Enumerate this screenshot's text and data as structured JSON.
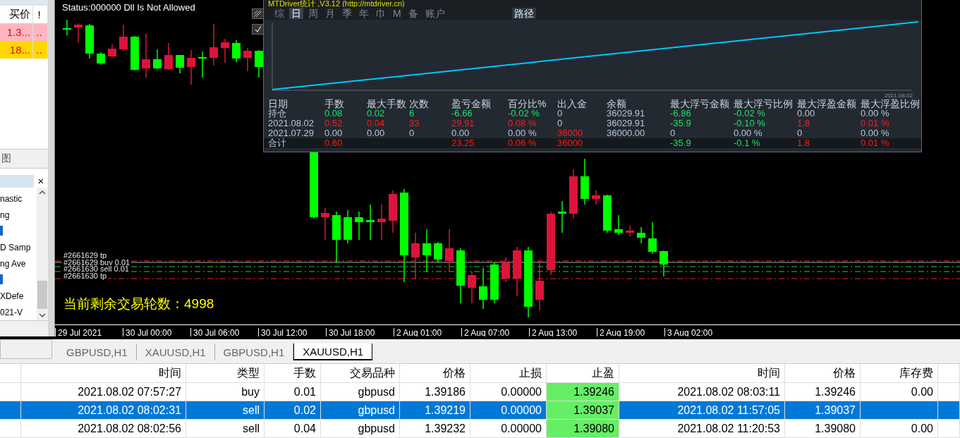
{
  "market_watch": {
    "columns": [
      "买价",
      "!"
    ],
    "rows": [
      {
        "cells": [
          "1.3...",
          ".."
        ],
        "color": "#ffb6c1"
      },
      {
        "cells": [
          "18...",
          ".."
        ],
        "color": "#ffd700"
      }
    ]
  },
  "left_tab": "图",
  "navigator": {
    "close": "×",
    "items": [
      {
        "kind": "text",
        "label": "nastic"
      },
      {
        "kind": "text",
        "label": "ng"
      },
      {
        "kind": "icon"
      },
      {
        "kind": "text",
        "label": "D Samp"
      },
      {
        "kind": "text",
        "label": "ng Ave"
      },
      {
        "kind": "icon"
      },
      {
        "kind": "text",
        "label": "XDefe"
      },
      {
        "kind": "text",
        "label": "021-V"
      }
    ]
  },
  "chart": {
    "status": "Status:000000 Dll Is Not Allowed",
    "order_labels": [
      "#2661629 tp",
      "#2661629 buy 0.01",
      "#2661630 sell 0.01",
      "#2661630 tp"
    ],
    "rounds": "当前剩余交易轮数：4998",
    "time_axis": [
      "29 Jul 2021",
      "30 Jul 00:00",
      "30 Jul 06:00",
      "30 Jul 12:00",
      "30 Jul 18:00",
      "2 Aug 01:00",
      "2 Aug 07:00",
      "2 Aug 13:00",
      "2 Aug 19:00",
      "3 Aug 02:00"
    ]
  },
  "stats_panel": {
    "title": "MTDriver统计 ,V3.12 (http://mtdriver.cn)",
    "tabs": [
      {
        "label": "综",
        "selected": false
      },
      {
        "label": "日",
        "selected": true
      },
      {
        "label": "周",
        "selected": false
      },
      {
        "label": "月",
        "selected": false
      },
      {
        "label": "季",
        "selected": false
      },
      {
        "label": "年",
        "selected": false
      },
      {
        "label": "巾",
        "selected": false
      },
      {
        "label": "M",
        "selected": false
      },
      {
        "label": "备",
        "selected": false
      },
      {
        "label": "账户",
        "selected": false
      }
    ],
    "path_button": "路径",
    "chart_date": "2021.08.02",
    "columns": [
      "日期",
      "手数",
      "最大手数",
      "次数",
      "盈亏金额",
      "百分比%",
      "出入金",
      "余额",
      "最大浮亏金额",
      "最大浮亏比例",
      "最大浮盈金额",
      "最大浮盈比例"
    ],
    "rows": [
      {
        "kind": "period",
        "cells": [
          {
            "text": "持仓",
            "color": "#b8c4d8"
          },
          {
            "text": "0.08",
            "color": "#19e66a"
          },
          {
            "text": "0.02",
            "color": "#19e66a"
          },
          {
            "text": "6",
            "color": "#19e66a"
          },
          {
            "text": "-6.66",
            "color": "#19e66a"
          },
          {
            "text": "-0.02 %",
            "color": "#19e66a"
          },
          {
            "text": "0",
            "color": "#b8c4d8"
          },
          {
            "text": "36029.91",
            "color": "#b8c4d8"
          },
          {
            "text": "-6.86",
            "color": "#19e66a"
          },
          {
            "text": "-0.02 %",
            "color": "#19e66a"
          },
          {
            "text": "0.00",
            "color": "#b8c4d8"
          },
          {
            "text": "0.00 %",
            "color": "#b8c4d8"
          }
        ]
      },
      {
        "kind": "period",
        "cells": [
          {
            "text": "2021.08.02",
            "color": "#b8c4d8"
          },
          {
            "text": "0.52",
            "color": "#ff1a1a"
          },
          {
            "text": "0.04",
            "color": "#ff1a1a"
          },
          {
            "text": "33",
            "color": "#ff1a1a"
          },
          {
            "text": "29.91",
            "color": "#ff1a1a"
          },
          {
            "text": "0.08 %",
            "color": "#ff1a1a"
          },
          {
            "text": "0",
            "color": "#b8c4d8"
          },
          {
            "text": "36029.91",
            "color": "#b8c4d8"
          },
          {
            "text": "-35.9",
            "color": "#19e66a"
          },
          {
            "text": "-0.10 %",
            "color": "#19e66a"
          },
          {
            "text": "1.8",
            "color": "#ff1a1a"
          },
          {
            "text": "0.01 %",
            "color": "#ff1a1a"
          }
        ]
      },
      {
        "kind": "period",
        "cells": [
          {
            "text": "2021.07.29",
            "color": "#b8c4d8"
          },
          {
            "text": "0.00",
            "color": "#b8c4d8"
          },
          {
            "text": "0.00",
            "color": "#b8c4d8"
          },
          {
            "text": "0",
            "color": "#b8c4d8"
          },
          {
            "text": "0.00",
            "color": "#b8c4d8"
          },
          {
            "text": "0.00 %",
            "color": "#b8c4d8"
          },
          {
            "text": "36000",
            "color": "#ff1a1a"
          },
          {
            "text": "36000.00",
            "color": "#b8c4d8"
          },
          {
            "text": "0",
            "color": "#b8c4d8"
          },
          {
            "text": "0.00 %",
            "color": "#b8c4d8"
          },
          {
            "text": "0",
            "color": "#b8c4d8"
          },
          {
            "text": "0.00 %",
            "color": "#b8c4d8"
          }
        ]
      },
      {
        "kind": "total",
        "cells": [
          {
            "text": "合计",
            "color": "#b8c4d8"
          },
          {
            "text": "0.60",
            "color": "#ff1a1a"
          },
          null,
          null,
          {
            "text": "23.25",
            "color": "#ff1a1a"
          },
          {
            "text": "0.06 %",
            "color": "#ff1a1a"
          },
          {
            "text": "36000",
            "color": "#ff1a1a"
          },
          null,
          {
            "text": "-35.9",
            "color": "#19e66a"
          },
          {
            "text": "-0.1 %",
            "color": "#19e66a"
          },
          {
            "text": "1.8",
            "color": "#ff1a1a"
          },
          {
            "text": "0.01 %",
            "color": "#ff1a1a"
          }
        ]
      }
    ]
  },
  "chart_tabs": [
    {
      "label": "GBPUSD,H1",
      "selected": false
    },
    {
      "label": "XAUUSD,H1",
      "selected": false
    },
    {
      "label": "GBPUSD,H1",
      "selected": false
    },
    {
      "label": "XAUUSD,H1",
      "selected": true
    }
  ],
  "orders": {
    "columns": [
      {
        "label": "时间",
        "highlight": false
      },
      {
        "label": "类型",
        "highlight": false
      },
      {
        "label": "手数",
        "highlight": false
      },
      {
        "label": "交易品种",
        "highlight": false
      },
      {
        "label": "价格",
        "highlight": false
      },
      {
        "label": "止损",
        "highlight": false
      },
      {
        "label": "止盈",
        "highlight": true
      },
      {
        "label": "时间",
        "highlight": false
      },
      {
        "label": "价格",
        "highlight": false
      },
      {
        "label": "库存费",
        "highlight": false
      }
    ],
    "rows": [
      {
        "selected": false,
        "cells": [
          "2021.08.02 07:57:27",
          "buy",
          "0.01",
          "gbpusd",
          "1.39186",
          "0.00000",
          "1.39246",
          "2021.08.02 08:03:11",
          "1.39246",
          "0.00"
        ]
      },
      {
        "selected": true,
        "cells": [
          "2021.08.02 08:02:31",
          "sell",
          "0.02",
          "gbpusd",
          "1.39219",
          "0.00000",
          "1.39037",
          "2021.08.02 11:57:05",
          "1.39037",
          null
        ]
      },
      {
        "selected": false,
        "cells": [
          "2021.08.02 08:02:56",
          "sell",
          "0.04",
          "gbpusd",
          "1.39232",
          "0.00000",
          "1.39080",
          "2021.08.02 11:20:53",
          "1.39080",
          "0.00"
        ]
      }
    ]
  }
}
